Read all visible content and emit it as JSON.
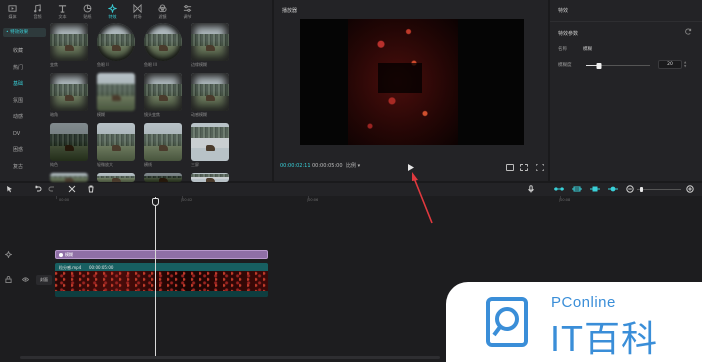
{
  "toolbar": {
    "items": [
      {
        "label": "媒体",
        "icon": "media-icon"
      },
      {
        "label": "音频",
        "icon": "audio-icon"
      },
      {
        "label": "文本",
        "icon": "text-icon"
      },
      {
        "label": "贴纸",
        "icon": "sticker-icon"
      },
      {
        "label": "特效",
        "icon": "effects-icon",
        "active": true
      },
      {
        "label": "转场",
        "icon": "transition-icon"
      },
      {
        "label": "滤镜",
        "icon": "filter-icon"
      },
      {
        "label": "调节",
        "icon": "adjust-icon"
      }
    ]
  },
  "categories": {
    "header": "• 特效效果",
    "items": [
      "收藏",
      "热门",
      "基础",
      "氛围",
      "动感",
      "DV",
      "困惑",
      "复古"
    ],
    "active_index": 2
  },
  "effects": [
    {
      "label": "变焦",
      "style": "vignette"
    },
    {
      "label": "鱼眼 II",
      "style": "round"
    },
    {
      "label": "鱼眼 III",
      "style": "round"
    },
    {
      "label": "边缘模糊",
      "style": "vignette"
    },
    {
      "label": "暗角",
      "style": "vignette"
    },
    {
      "label": "模糊",
      "style": "blur"
    },
    {
      "label": "镜头变焦",
      "style": "vignette"
    },
    {
      "label": "动感模糊",
      "style": "vignette"
    },
    {
      "label": "纯色",
      "style": "dark"
    },
    {
      "label": "轻微放大",
      "style": "plain"
    },
    {
      "label": "横线",
      "style": "plain"
    },
    {
      "label": "三屏",
      "style": "split"
    },
    {
      "label": "虚化",
      "style": "blur"
    },
    {
      "label": "轻微放大",
      "style": "plain"
    },
    {
      "label": "模糊",
      "style": "dark"
    },
    {
      "label": "马赛克",
      "style": "split"
    }
  ],
  "player": {
    "title": "播放器",
    "current_time": "00:00:02:11",
    "total_time": "00:00:05:00",
    "ratio": "比例 ▾"
  },
  "effect_panel": {
    "title": "特效",
    "section": "特效参数",
    "name_label": "名称",
    "name_value": "模糊",
    "slider_label": "模糊度",
    "value": "20",
    "value_fraction": 0.2
  },
  "timeline": {
    "ruler_ticks": [
      "00:00",
      "|00:02",
      "|00:06",
      "|00:08"
    ],
    "effect_clip_label": "模糊",
    "video_clip_name": "粒分感.mp4",
    "video_clip_duration": "00:00:05:00",
    "cover_label": "封面"
  },
  "watermark": {
    "sub": "PConline",
    "main": "IT百科"
  },
  "colors": {
    "accent": "#39d0d8",
    "effect_clip": "#8f6fa6",
    "video_clip": "#175f61",
    "annotation_arrow": "#e0393e",
    "watermark_blue": "#3a8ed8"
  }
}
